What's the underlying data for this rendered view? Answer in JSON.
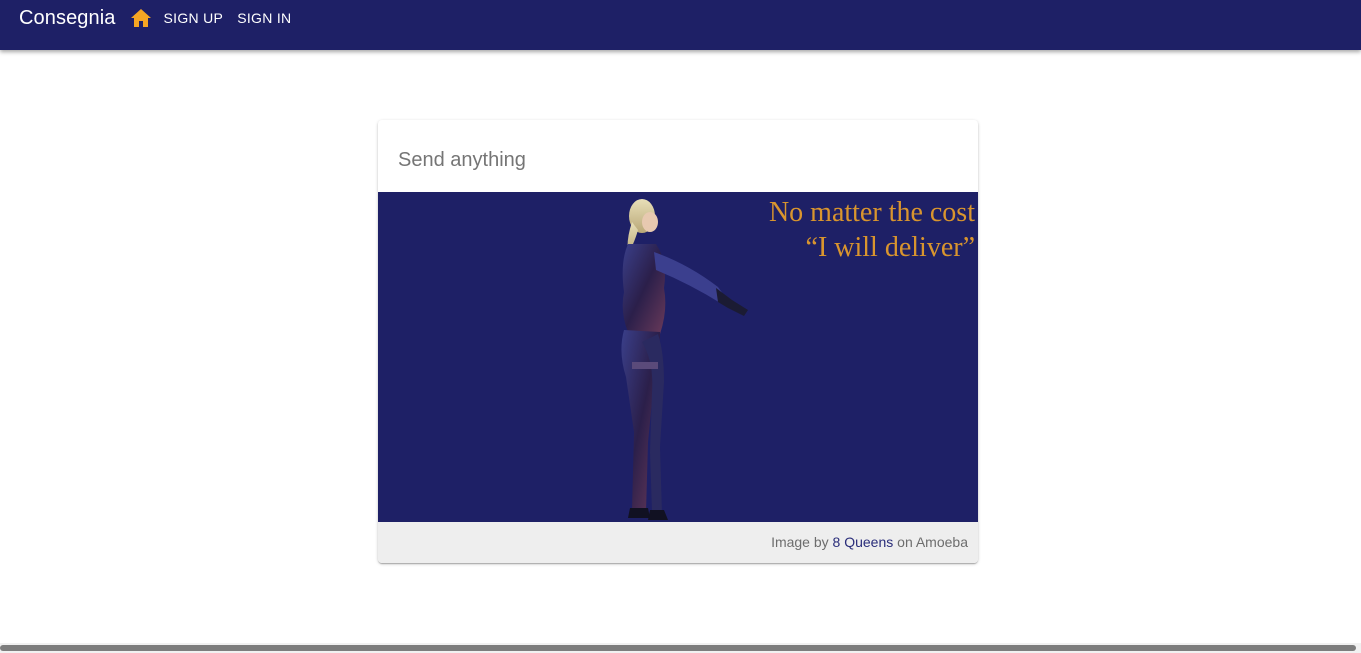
{
  "header": {
    "brand": "Consegnia",
    "home_icon": "home-icon",
    "nav": {
      "sign_up": "SIGN UP",
      "sign_in": "SIGN IN"
    },
    "colors": {
      "bar": "#1e2066",
      "icon": "#f5a623"
    }
  },
  "card": {
    "title": "Send anything",
    "hero": {
      "line1": "No matter the cost",
      "line2": "“I will deliver”",
      "background": "#1e2066",
      "text_color": "#d9952e"
    },
    "caption": {
      "prefix": "Image by",
      "author": "8 Queens",
      "suffix": "on Amoeba"
    }
  }
}
